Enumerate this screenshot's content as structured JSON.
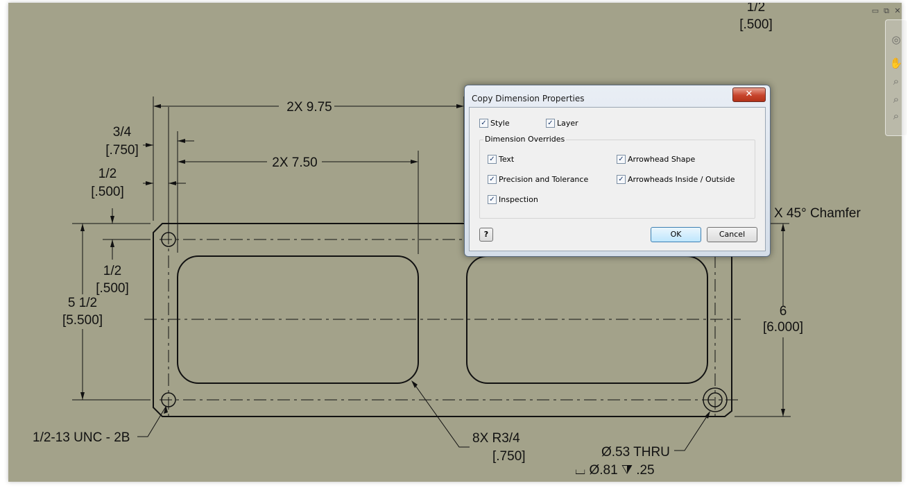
{
  "drawing": {
    "dims": {
      "top_half": "1/2",
      "top_half_in": "[.500]",
      "width_975": "2X 9.75",
      "width_750": "2X 7.50",
      "three_quarter": "3/4",
      "three_quarter_in": "[.750]",
      "left_half": "1/2",
      "left_half_in": "[.500]",
      "hole_half": "1/2",
      "hole_half_in": "[.500]",
      "height_55": "5 1/2",
      "height_55_in": "[5.500]",
      "height_6": "6",
      "height_6_in": "[6.000]",
      "chamfer": "X 45° Chamfer",
      "thread": "1/2-13 UNC - 2B",
      "radius": "8X  R3/4",
      "radius_in": "[.750]",
      "thru": "Ø.53 THRU",
      "cbore": "⌴ Ø.81 ⧩ .25"
    }
  },
  "window_controls": {
    "minimize": "▭",
    "restore": "⧉",
    "close": "✕"
  },
  "navbar": {
    "icons": [
      "steering-wheel-icon",
      "pan-icon",
      "zoom-icon",
      "zoom-window-icon",
      "orbit-icon"
    ]
  },
  "dialog": {
    "title": "Copy Dimension Properties",
    "close_label": "✕",
    "style_label": "Style",
    "style_checked": true,
    "layer_label": "Layer",
    "layer_checked": true,
    "overrides_label": "Dimension Overrides",
    "text_label": "Text",
    "precision_label": "Precision and Tolerance",
    "inspection_label": "Inspection",
    "arrowhead_shape_label": "Arrowhead Shape",
    "arrowheads_inside_label": "Arrowheads Inside / Outside",
    "check_mark": "✓",
    "help_label": "?",
    "ok_label": "OK",
    "cancel_label": "Cancel"
  }
}
